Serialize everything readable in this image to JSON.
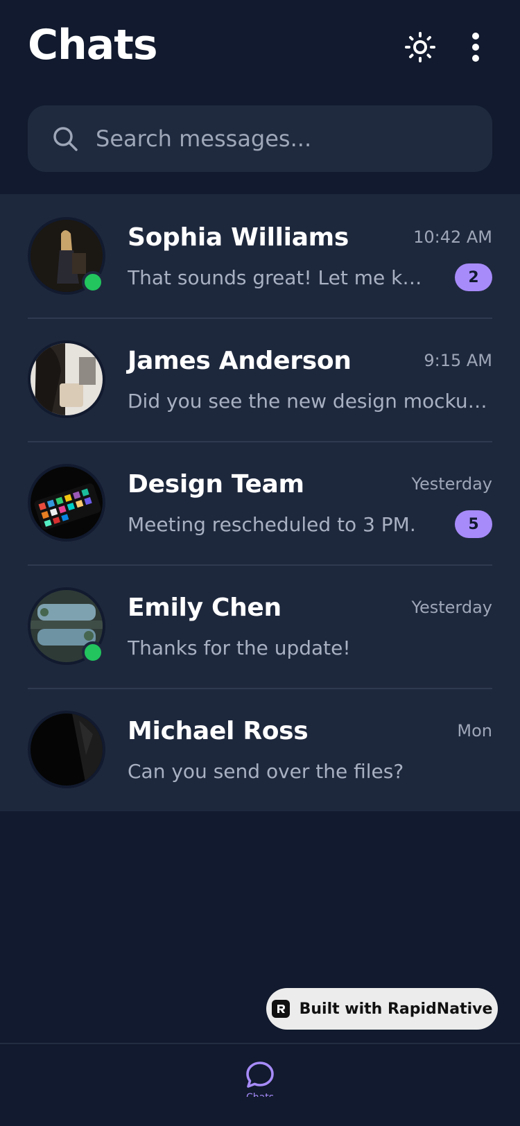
{
  "header": {
    "title": "Chats",
    "theme_icon": "sun-icon",
    "more_icon": "more-vertical-icon"
  },
  "search": {
    "placeholder": "Search messages...",
    "icon": "search-icon"
  },
  "chats": [
    {
      "name": "Sophia Williams",
      "time": "10:42 AM",
      "preview": "That sounds great! Let me know when you're free.",
      "unread": "2",
      "online": true
    },
    {
      "name": "James Anderson",
      "time": "9:15 AM",
      "preview": "Did you see the new design mockups?",
      "unread": null,
      "online": false
    },
    {
      "name": "Design Team",
      "time": "Yesterday",
      "preview": "Meeting rescheduled to 3 PM.",
      "unread": "5",
      "online": false
    },
    {
      "name": "Emily Chen",
      "time": "Yesterday",
      "preview": "Thanks for the update!",
      "unread": null,
      "online": true
    },
    {
      "name": "Michael Ross",
      "time": "Mon",
      "preview": "Can you send over the files?",
      "unread": null,
      "online": false
    }
  ],
  "built_with": {
    "label": "Built with RapidNative",
    "logo": "rapidnative-logo-icon"
  },
  "tabbar": {
    "chats_icon": "chat-bubble-icon",
    "chats_label": "Chats"
  },
  "colors": {
    "background": "#111a2e",
    "surface": "#1e283d",
    "accent": "#a78bfa",
    "online": "#22c55e"
  }
}
